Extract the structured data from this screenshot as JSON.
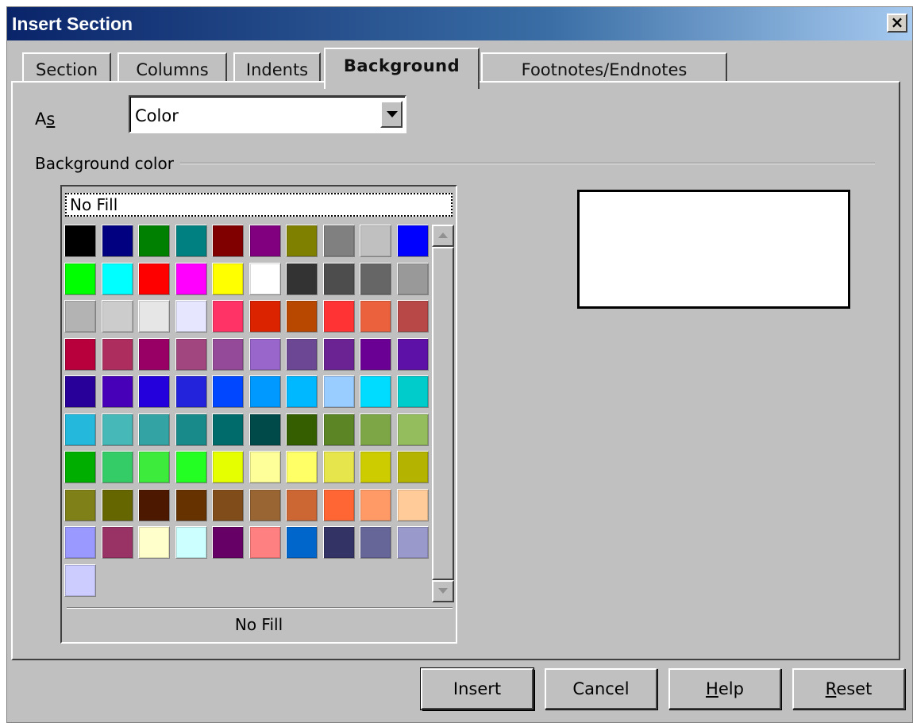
{
  "window": {
    "title": "Insert Section",
    "close_icon": "close-icon"
  },
  "tabs": [
    {
      "label": "Section",
      "active": false
    },
    {
      "label": "Columns",
      "active": false
    },
    {
      "label": "Indents",
      "active": false
    },
    {
      "label": "Background",
      "active": true
    },
    {
      "label": "Footnotes/Endnotes",
      "active": false
    }
  ],
  "as_field": {
    "label_prefix": "A",
    "label_mnemonic": "s",
    "value": "Color"
  },
  "background_color": {
    "group_label": "Background color",
    "no_fill_item": "No Fill",
    "selected_label": "No Fill",
    "preview_color": "#ffffff",
    "palette": [
      "#000000",
      "#000080",
      "#008000",
      "#008080",
      "#800000",
      "#800080",
      "#808000",
      "#808080",
      "#c0c0c0",
      "#0000ff",
      "#00ff00",
      "#00ffff",
      "#ff0000",
      "#ff00ff",
      "#ffff00",
      "#ffffff",
      "#333333",
      "#4d4d4d",
      "#666666",
      "#999999",
      "#b3b3b3",
      "#cccccc",
      "#e6e6e6",
      "#e6e6ff",
      "#ff3366",
      "#dc2300",
      "#b84700",
      "#ff3333",
      "#eb613d",
      "#b84747",
      "#b8003d",
      "#ad2e5e",
      "#990066",
      "#a1467e",
      "#944a98",
      "#9966cc",
      "#6b4794",
      "#6b2394",
      "#6b0094",
      "#5e11a6",
      "#280099",
      "#4700b8",
      "#2300dc",
      "#2323dc",
      "#0047ff",
      "#0099ff",
      "#00b8ff",
      "#99ccff",
      "#00dcff",
      "#00cccc",
      "#23b8dc",
      "#47b8b8",
      "#33a3a3",
      "#198a8a",
      "#006b6b",
      "#004a4a",
      "#355e00",
      "#5c8526",
      "#7da647",
      "#94bd5e",
      "#00ae00",
      "#33cc66",
      "#3deb3d",
      "#23ff23",
      "#e6ff00",
      "#ffff99",
      "#ffff66",
      "#e6e64c",
      "#cccc00",
      "#b3b300",
      "#808019",
      "#666600",
      "#4c1900",
      "#663300",
      "#804c19",
      "#996633",
      "#cc6633",
      "#ff6633",
      "#ff9966",
      "#ffcc99",
      "#9999ff",
      "#993366",
      "#ffffcc",
      "#ccffff",
      "#660066",
      "#ff8080",
      "#0066cc",
      "#333366",
      "#666699",
      "#9999cc",
      "#ccccff"
    ]
  },
  "buttons": {
    "insert": "Insert",
    "cancel": "Cancel",
    "help_mnemonic": "H",
    "help_rest": "elp",
    "reset_mnemonic": "R",
    "reset_rest": "eset"
  }
}
